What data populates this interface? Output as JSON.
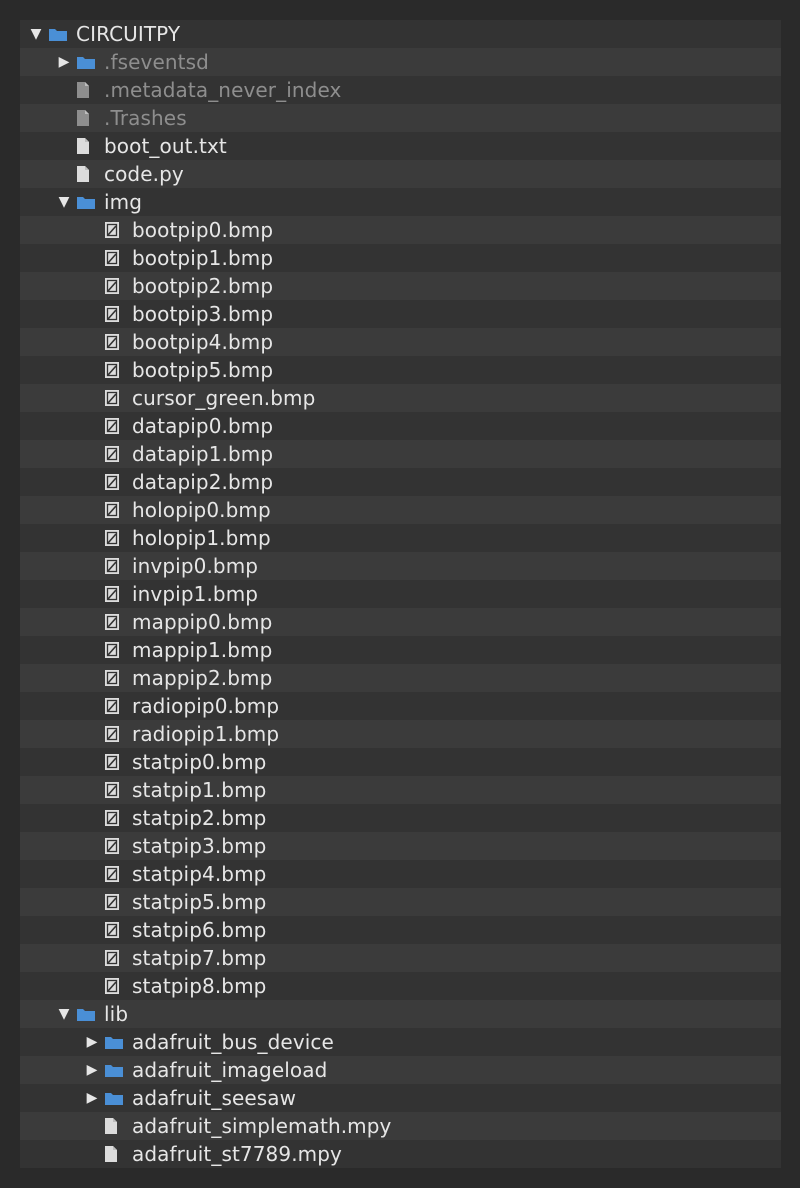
{
  "tree": {
    "root": {
      "label": "CIRCUITPY",
      "expanded": true
    },
    "top_items": [
      {
        "label": ".fseventsd",
        "type": "folder",
        "expanded": false,
        "dim": true
      },
      {
        "label": ".metadata_never_index",
        "type": "file",
        "dim": true
      },
      {
        "label": ".Trashes",
        "type": "file",
        "dim": true
      },
      {
        "label": "boot_out.txt",
        "type": "file",
        "dim": false
      },
      {
        "label": "code.py",
        "type": "file",
        "dim": false
      }
    ],
    "img": {
      "label": "img",
      "expanded": true,
      "files": [
        "bootpip0.bmp",
        "bootpip1.bmp",
        "bootpip2.bmp",
        "bootpip3.bmp",
        "bootpip4.bmp",
        "bootpip5.bmp",
        "cursor_green.bmp",
        "datapip0.bmp",
        "datapip1.bmp",
        "datapip2.bmp",
        "holopip0.bmp",
        "holopip1.bmp",
        "invpip0.bmp",
        "invpip1.bmp",
        "mappip0.bmp",
        "mappip1.bmp",
        "mappip2.bmp",
        "radiopip0.bmp",
        "radiopip1.bmp",
        "statpip0.bmp",
        "statpip1.bmp",
        "statpip2.bmp",
        "statpip3.bmp",
        "statpip4.bmp",
        "statpip5.bmp",
        "statpip6.bmp",
        "statpip7.bmp",
        "statpip8.bmp"
      ]
    },
    "lib": {
      "label": "lib",
      "expanded": true,
      "items": [
        {
          "label": "adafruit_bus_device",
          "type": "folder",
          "expanded": false
        },
        {
          "label": "adafruit_imageload",
          "type": "folder",
          "expanded": false
        },
        {
          "label": "adafruit_seesaw",
          "type": "folder",
          "expanded": false
        },
        {
          "label": "adafruit_simplemath.mpy",
          "type": "file"
        },
        {
          "label": "adafruit_st7789.mpy",
          "type": "file"
        }
      ]
    }
  },
  "colors": {
    "folder": "#4a8fd6",
    "file": "#dcdcdc",
    "dim_file": "#8e8e8e"
  },
  "icons": {
    "folder": "folder-icon",
    "file": "file-icon",
    "image_file": "image-file-icon",
    "expanded": "triangle-down-icon",
    "collapsed": "triangle-right-icon"
  }
}
